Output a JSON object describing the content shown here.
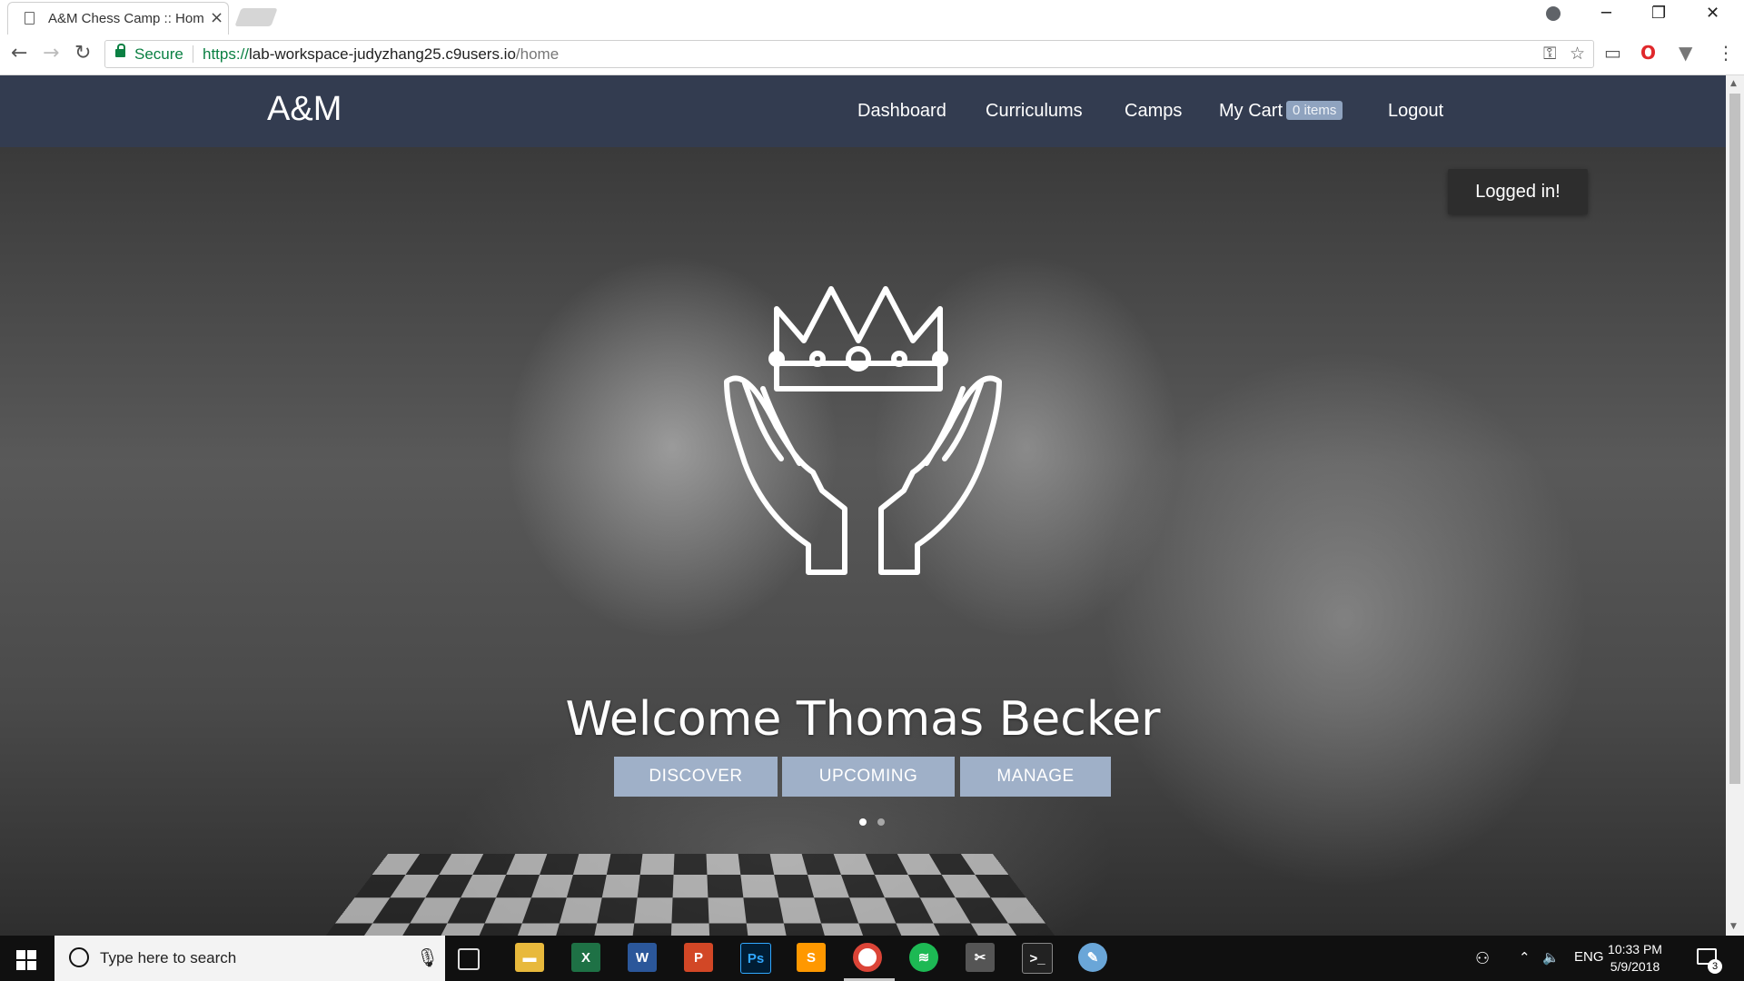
{
  "browser": {
    "tab_title": "A&M Chess Camp :: Hom",
    "secure_label": "Secure",
    "url_scheme": "https://",
    "url_host": "lab-workspace-judyzhang25.c9users.io",
    "url_path": "/home"
  },
  "navbar": {
    "brand": "A&M",
    "links": {
      "dashboard": "Dashboard",
      "curriculums": "Curriculums",
      "camps": "Camps",
      "cart": "My Cart",
      "cart_badge": "0 items",
      "logout": "Logout"
    },
    "background_color": "#333c50"
  },
  "hero": {
    "welcome": "Welcome Thomas Becker",
    "buttons": {
      "discover": "DISCOVER",
      "upcoming": "UPCOMING",
      "manage": "MANAGE"
    },
    "button_color": "#9fb0c8",
    "carousel_active_index": 0,
    "carousel_slide_count": 2
  },
  "flash": {
    "message": "Logged in!"
  },
  "taskbar": {
    "search_placeholder": "Type here to search",
    "language": "ENG",
    "time": "10:33 PM",
    "date": "5/9/2018",
    "notification_count": "3",
    "apps": [
      "file-explorer-icon",
      "excel-icon",
      "word-icon",
      "powerpoint-icon",
      "photoshop-icon",
      "sublime-text-icon",
      "chrome-icon",
      "spotify-icon",
      "snipping-tool-icon",
      "terminal-icon",
      "paint-icon"
    ]
  }
}
